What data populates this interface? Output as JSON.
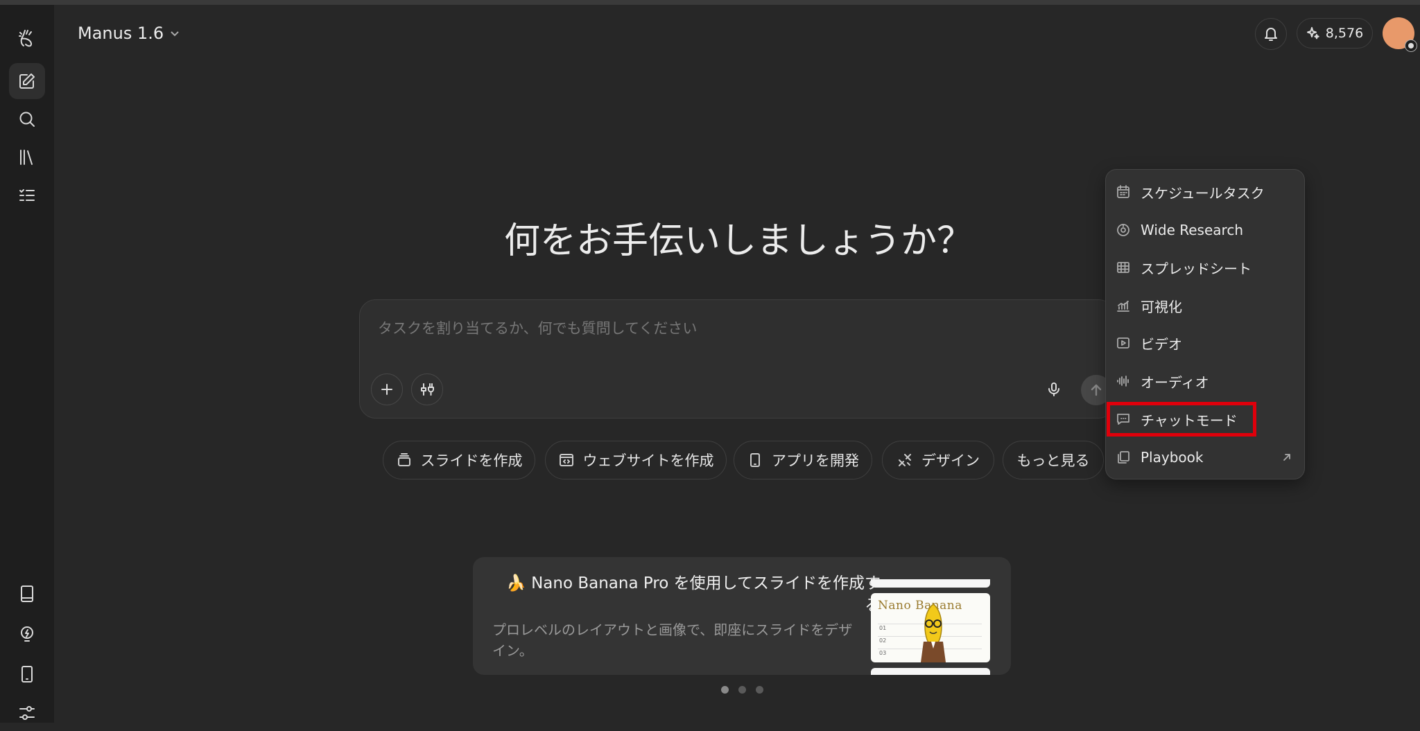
{
  "header": {
    "model_label": "Manus 1.6",
    "credits": "8,576"
  },
  "main": {
    "headline": "何をお手伝いしましょうか？",
    "input_placeholder": "タスクを割り当てるか、何でも質問してください"
  },
  "chips": [
    {
      "label": "スライドを作成",
      "icon": "slides-icon"
    },
    {
      "label": "ウェブサイトを作成",
      "icon": "code-window-icon"
    },
    {
      "label": "アプリを開発",
      "icon": "mobile-icon"
    },
    {
      "label": "デザイン",
      "icon": "design-icon"
    },
    {
      "label": "もっと見る",
      "icon": ""
    }
  ],
  "menu": {
    "items": [
      {
        "label": "スケジュールタスク",
        "icon": "calendar-icon"
      },
      {
        "label": "Wide Research",
        "icon": "research-icon"
      },
      {
        "label": "スプレッドシート",
        "icon": "table-icon"
      },
      {
        "label": "可視化",
        "icon": "chart-icon"
      },
      {
        "label": "ビデオ",
        "icon": "video-icon"
      },
      {
        "label": "オーディオ",
        "icon": "audio-icon"
      },
      {
        "label": "チャットモード",
        "icon": "chat-icon",
        "highlighted": true
      },
      {
        "label": "Playbook",
        "icon": "playbook-icon",
        "external": true
      }
    ]
  },
  "promo": {
    "emoji": "🍌",
    "title": "Nano Banana Pro を使用してスライドを作成する",
    "subtitle": "プロレベルのレイアウトと画像で、即座にスライドをデザイン。",
    "thumb_title": "Nano Banana",
    "thumb_numbers": [
      "01",
      "02",
      "03"
    ]
  },
  "carousel": {
    "total": 3,
    "active": 1
  },
  "colors": {
    "background": "#272727",
    "sidebar": "#1e1e1e",
    "avatar": "#e8996a",
    "highlight": "#e0000b"
  }
}
